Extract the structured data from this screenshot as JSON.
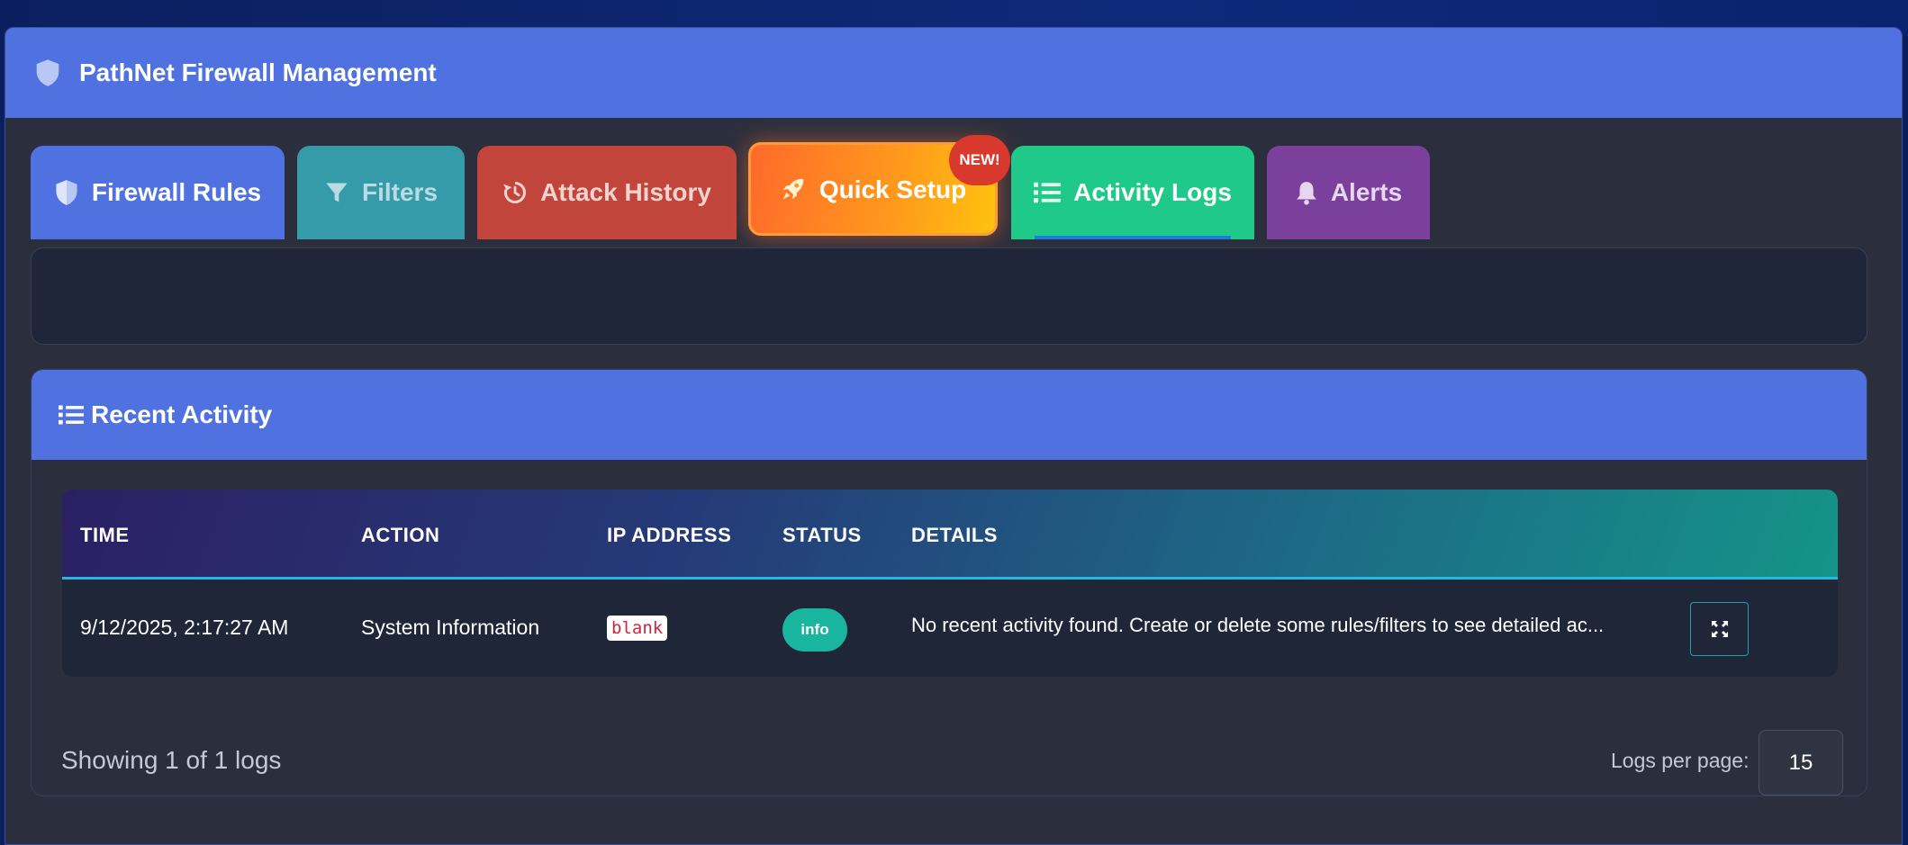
{
  "app": {
    "title": "PathNet Firewall Management"
  },
  "tabs": [
    {
      "label": "Firewall Rules",
      "icon": "shield-icon"
    },
    {
      "label": "Filters",
      "icon": "filter-icon"
    },
    {
      "label": "Attack History",
      "icon": "history-icon"
    },
    {
      "label": "Quick Setup",
      "icon": "rocket-icon",
      "badge": "NEW!"
    },
    {
      "label": "Activity Logs",
      "icon": "list-icon",
      "active": true
    },
    {
      "label": "Alerts",
      "icon": "bell-icon"
    }
  ],
  "activity": {
    "title": "Recent Activity",
    "columns": [
      "TIME",
      "ACTION",
      "IP ADDRESS",
      "STATUS",
      "DETAILS"
    ],
    "rows": [
      {
        "time": "9/12/2025, 2:17:27 AM",
        "action": "System Information",
        "ip": "blank",
        "status": "info",
        "details": "No recent activity found. Create or delete some rules/filters to see detailed ac..."
      }
    ],
    "showing": "Showing 1 of 1 logs",
    "per_page_label": "Logs per page:",
    "per_page_value": "15"
  },
  "colors": {
    "header": "#5072e0",
    "firewall_rules": "#5072e0",
    "filters": "#369ba8",
    "attack_history": "#c2453c",
    "quick_setup": "#ff8a1f",
    "activity_logs": "#1fc98a",
    "alerts": "#7b3f9c",
    "status_info": "#1ab59e",
    "badge_new": "#d9392d"
  }
}
